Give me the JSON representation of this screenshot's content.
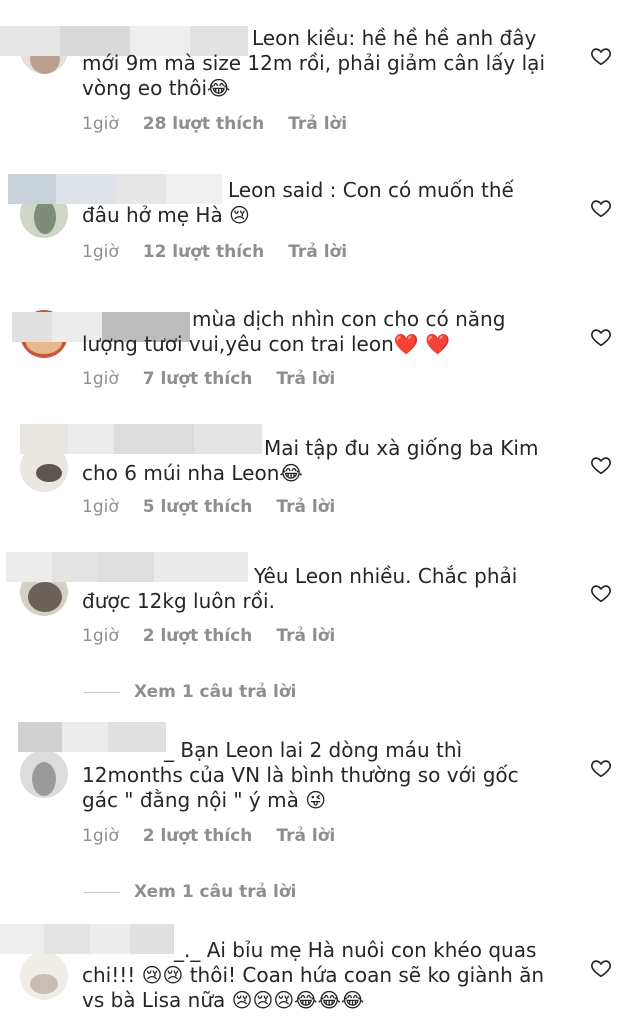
{
  "comments": [
    {
      "text": "Leon kiều: hề hề hề  anh đây mới 9m mà size 12m rồi, phải giảm cân lấy lại vòng eo thôi😂",
      "time": "1giờ",
      "likes": "28 lượt thích",
      "reply": "Trả lời"
    },
    {
      "text": "Leon said : Con có muốn thế đâu hở mẹ Hà 😢",
      "time": "1giờ",
      "likes": "12 lượt thích",
      "reply": "Trả lời"
    },
    {
      "text": "mùa dịch nhìn con cho có năng lượng tươi vui,yêu con trai leon❤️ ❤️",
      "time": "1giờ",
      "likes": "7 lượt thích",
      "reply": "Trả lời"
    },
    {
      "text": "Mai tập đu xà giống ba Kim cho 6 múi nha Leon😂",
      "time": "1giờ",
      "likes": "5 lượt thích",
      "reply": "Trả lời"
    },
    {
      "text": "Yêu Leon nhiều. Chắc phải được 12kg luôn rồi.",
      "time": "1giờ",
      "likes": "2 lượt thích",
      "reply": "Trả lời",
      "view_replies": "Xem 1 câu trả lời"
    },
    {
      "text": "_ Bạn Leon lai 2 dòng máu thì 12months của VN là bình thường so với gốc gác \" đằng nội \" ý mà 😜",
      "time": "1giờ",
      "likes": "2 lượt thích",
      "reply": "Trả lời",
      "view_replies": "Xem 1 câu trả lời"
    },
    {
      "text": "_._ Ai bỉu mẹ Hà nuôi con khéo quas chi!!! 😢😢 thôi! Coan hứa coan sẽ ko giành ăn vs bà Lisa nữa 😢😢😢😂😂😂"
    }
  ],
  "colors": {
    "text": "#262626",
    "muted": "#8e8e8e"
  },
  "icons": {
    "like": "heart-outline-icon"
  }
}
